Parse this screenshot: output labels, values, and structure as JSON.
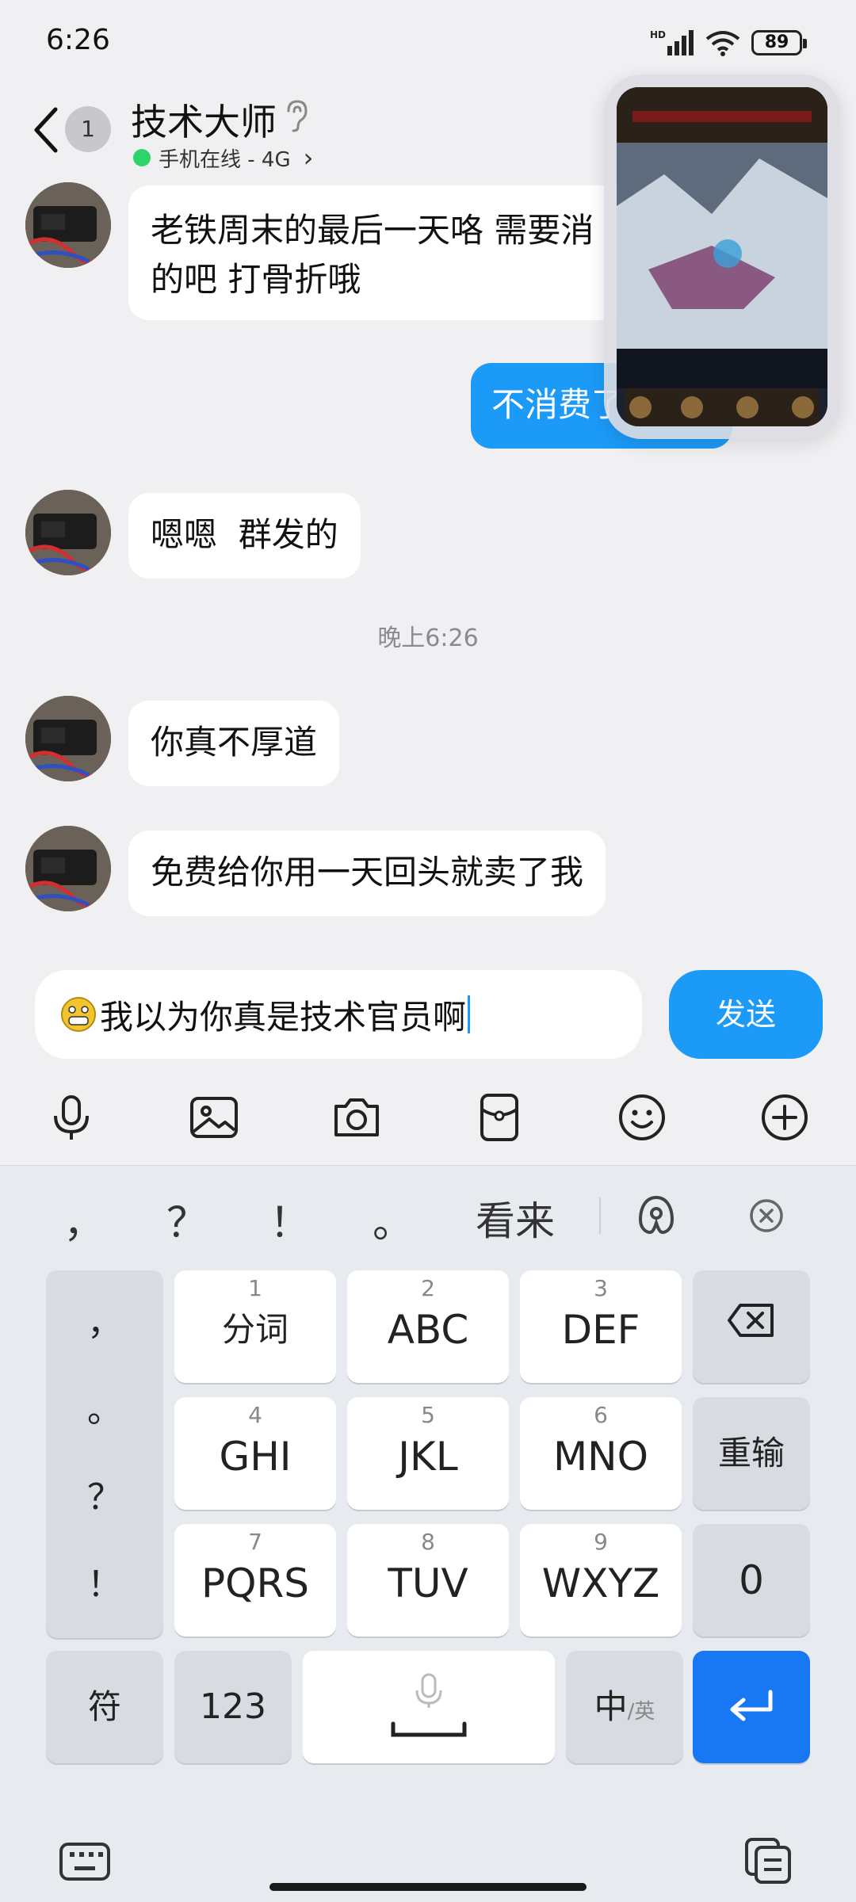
{
  "status": {
    "time": "6:26",
    "hd": "HD",
    "battery": "89"
  },
  "header": {
    "unread_count": "1",
    "contact_name": "技术大师",
    "online_status": "手机在线 - 4G",
    "online_chevron": "›"
  },
  "messages": [
    {
      "direction": "in",
      "text_line1": "老铁周末的最后一天咯 需要消",
      "text_line2": "的吧 打骨折哦"
    },
    {
      "direction": "out",
      "text": "不消费了"
    },
    {
      "direction": "in",
      "text": "嗯嗯  群发的"
    },
    {
      "direction": "in",
      "text": "你真不厚道"
    },
    {
      "direction": "in",
      "text": "免费给你用一天回头就卖了我"
    }
  ],
  "timestamp": "晚上6:26",
  "composer": {
    "input_value": "我以为你真是技术官员啊",
    "send_label": "发送"
  },
  "toolbar_icons": [
    "microphone-icon",
    "image-icon",
    "camera-icon",
    "red-packet-icon",
    "emoji-icon",
    "plus-icon"
  ],
  "keyboard": {
    "candidates": {
      "c1": "，",
      "c2": "？",
      "c3": "！",
      "c4": "。",
      "word": "看来"
    },
    "side_symbols": {
      "s1": "，",
      "s2": "。",
      "s3": "？",
      "s4": "！"
    },
    "keys": {
      "k1": {
        "num": "1",
        "label": "分词"
      },
      "k2": {
        "num": "2",
        "label": "ABC"
      },
      "k3": {
        "num": "3",
        "label": "DEF"
      },
      "k4": {
        "num": "4",
        "label": "GHI"
      },
      "k5": {
        "num": "5",
        "label": "JKL"
      },
      "k6": {
        "num": "6",
        "label": "MNO"
      },
      "k7": {
        "num": "7",
        "label": "PQRS"
      },
      "k8": {
        "num": "8",
        "label": "TUV"
      },
      "k9": {
        "num": "9",
        "label": "WXYZ"
      }
    },
    "retype_label": "重输",
    "zero_label": "0",
    "symbol_label": "符",
    "num_label": "123",
    "lang_main": "中",
    "lang_sub": "/英"
  }
}
